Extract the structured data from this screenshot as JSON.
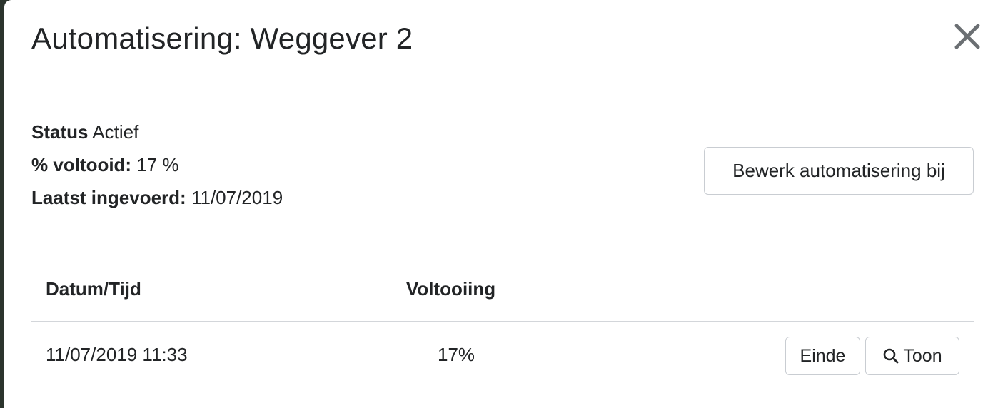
{
  "modal": {
    "title": "Automatisering: Weggever 2",
    "close_icon": "close-icon"
  },
  "info": {
    "status_label": "Status",
    "status_value": "Actief",
    "completed_label": "% voltooid:",
    "completed_value": "17 %",
    "last_entered_label": "Laatst ingevoerd:",
    "last_entered_value": "11/07/2019"
  },
  "edit_button_label": "Bewerk automatisering bij",
  "table": {
    "columns": [
      "Datum/Tijd",
      "Voltooiing"
    ],
    "rows": [
      {
        "datetime": "11/07/2019 11:33",
        "completion": "17%",
        "end_button": "Einde",
        "show_button": "Toon",
        "show_icon": "search-icon"
      }
    ]
  }
}
